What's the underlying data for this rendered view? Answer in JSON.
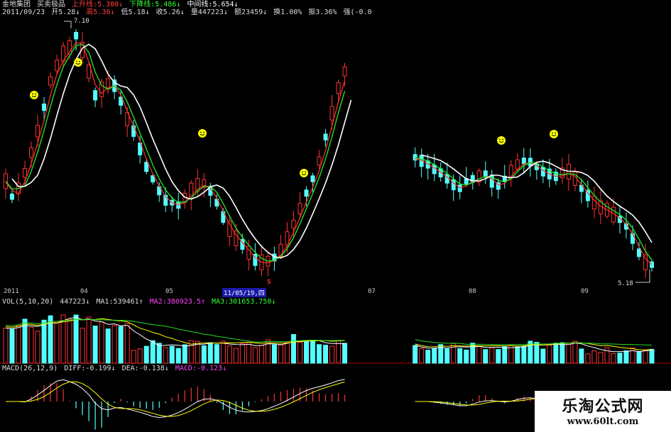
{
  "header": {
    "stock_name": "金地集团",
    "indicator_name": "买卖极品",
    "upper_line": "上升线:5.380↓",
    "lower_line": "下降线:5.486↓",
    "mid_line": "中间线:5.654↓",
    "date": "2011/09/23",
    "open": "开5.28↓",
    "high": "高5.36↓",
    "low": "低5.18↓",
    "close": "收5.26↓",
    "volume": "量447223↓",
    "amount": "额23459↓",
    "turnover": "换1.00%",
    "amplitude": "振3.36%",
    "strength": "强(-0.0"
  },
  "price_labels": {
    "max": "7.10",
    "min": "5.18"
  },
  "time_axis": {
    "labels": [
      "2011",
      "04",
      "05",
      "11/05/19,四",
      "07",
      "08",
      "09"
    ],
    "highlight": "11/05/19,四",
    "marker": "S"
  },
  "volume": {
    "label": "VOL(5,10,20)",
    "value": "447223↓",
    "ma1": "MA1:539461↑",
    "ma2": "MA2:380923.5↑",
    "ma3": "MA3:301653.750↓"
  },
  "macd": {
    "label": "MACD(26,12,9)",
    "diff": "DIFF:-0.199↓",
    "dea": "DEA:-0.138↓",
    "macd": "MACD:-0.123↓"
  },
  "watermark": {
    "name": "乐淘公式网",
    "url": "www.60lt.com"
  },
  "colors": {
    "up": "#ff3333",
    "down": "#54ffff",
    "white_line": "#ffffff",
    "green_line": "#22dd22",
    "red_line": "#ff3030",
    "yellow": "#ffff00",
    "magenta": "#ff44ff",
    "header_red": "#ff4040",
    "header_green": "#33ff33"
  },
  "price_series": [
    5.88,
    5.75,
    5.82,
    5.95,
    6.12,
    6.3,
    6.5,
    6.72,
    6.85,
    6.95,
    7.0,
    7.1,
    6.98,
    6.8,
    6.6,
    6.65,
    6.7,
    6.68,
    6.55,
    6.4,
    6.3,
    6.15,
    6.0,
    5.9,
    5.8,
    5.72,
    5.7,
    5.68,
    5.74,
    5.8,
    5.85,
    5.86,
    5.8,
    5.7,
    5.58,
    5.48,
    5.4,
    5.35,
    5.28,
    5.22,
    5.2,
    5.21,
    5.24,
    5.3,
    5.4,
    5.52,
    5.65,
    5.78,
    5.9,
    6.05,
    6.25,
    6.45,
    6.66,
    6.8,
    null,
    null,
    null,
    null,
    null,
    null,
    null,
    null,
    null,
    null,
    6.08,
    6.05,
    6.02,
    5.98,
    5.95,
    5.9,
    5.85,
    5.82,
    5.88,
    5.9,
    5.92,
    5.94,
    5.88,
    5.84,
    5.9,
    5.96,
    6.02,
    6.05,
    6.04,
    6.0,
    5.96,
    5.94,
    5.92,
    5.95,
    5.96,
    5.9,
    5.82,
    5.76,
    5.7,
    5.66,
    5.64,
    5.6,
    5.56,
    5.5,
    5.4,
    5.28,
    5.2,
    5.18
  ]
}
